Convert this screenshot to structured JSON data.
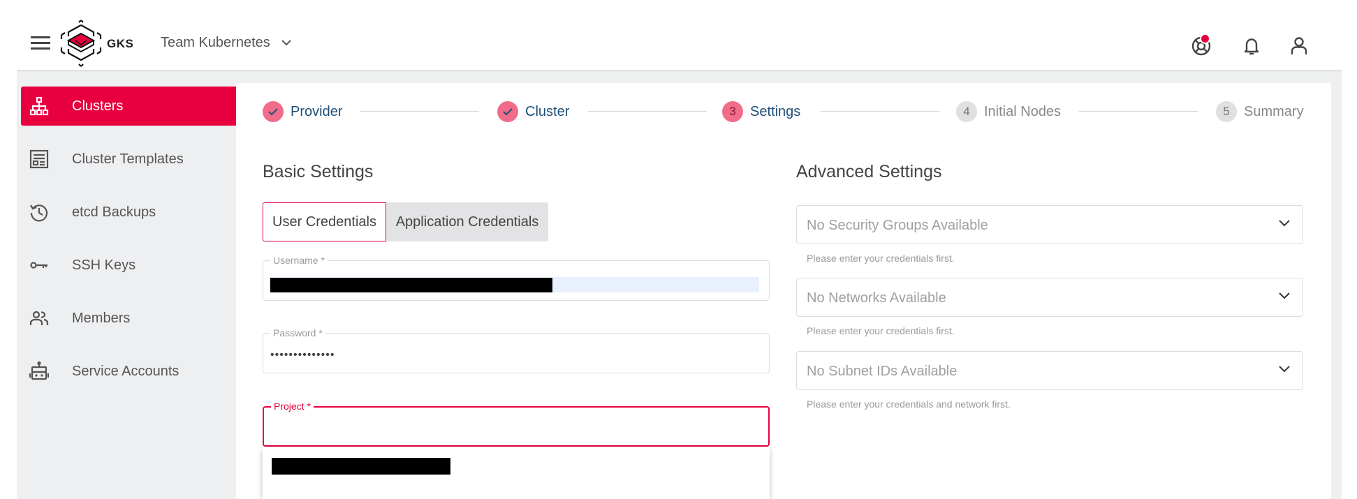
{
  "header": {
    "logo_text": "GKS",
    "project_name": "Team Kubernetes"
  },
  "sidebar": {
    "items": [
      {
        "label": "Clusters",
        "icon": "sitemap-icon"
      },
      {
        "label": "Cluster Templates",
        "icon": "template-icon"
      },
      {
        "label": "etcd Backups",
        "icon": "history-icon"
      },
      {
        "label": "SSH Keys",
        "icon": "key-icon"
      },
      {
        "label": "Members",
        "icon": "members-icon"
      },
      {
        "label": "Service Accounts",
        "icon": "robot-icon"
      }
    ]
  },
  "stepper": {
    "steps": [
      {
        "number": "",
        "label": "Provider",
        "state": "done"
      },
      {
        "number": "",
        "label": "Cluster",
        "state": "done"
      },
      {
        "number": "3",
        "label": "Settings",
        "state": "current"
      },
      {
        "number": "4",
        "label": "Initial Nodes",
        "state": "todo"
      },
      {
        "number": "5",
        "label": "Summary",
        "state": "todo"
      }
    ]
  },
  "basic": {
    "title": "Basic Settings",
    "tabs": {
      "user": "User Credentials",
      "application": "Application Credentials"
    },
    "username_label": "Username *",
    "password_label": "Password *",
    "password_value": "••••••••••••••",
    "project_label": "Project *"
  },
  "advanced": {
    "title": "Advanced Settings",
    "security_groups": "No Security Groups Available",
    "security_hint": "Please enter your credentials first.",
    "networks": "No Networks Available",
    "networks_hint": "Please enter your credentials first.",
    "subnets": "No Subnet IDs Available",
    "subnets_hint": "Please enter your credentials and network first."
  },
  "colors": {
    "accent": "#e8003e",
    "step_active": "#1e4f78",
    "step_circle": "#f06c8a"
  }
}
